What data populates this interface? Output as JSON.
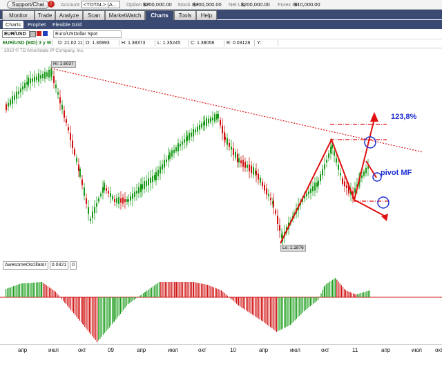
{
  "topbar": {
    "support_label": "Support/Chat",
    "alert_icon": "!",
    "account_label": "Account",
    "account_value": "<TOTAL> (A...",
    "option_bp_label": "Option BP",
    "option_bp_value": "$200,000.00",
    "stock_bp_label": "Stock BP",
    "stock_bp_value": "$300,000.00",
    "net_liq_label": "Net Liq",
    "net_liq_value": "$200,000.00",
    "forex_bp_label": "Forex BP",
    "forex_bp_value": "$10,000.00"
  },
  "tabs": [
    "Monitor",
    "Trade",
    "Analyze",
    "Scan",
    "MarketWatch",
    "Charts",
    "Tools",
    "Help"
  ],
  "active_tab": "Charts",
  "subtabs": [
    "Charts",
    "Prophet",
    "Flexible Grid"
  ],
  "symbol": {
    "ticker": "EUR/USD",
    "description": "Euro/USDollar Spot"
  },
  "info": {
    "period": "EUR/USD (BID) 3 y W",
    "date": "D: 21.02.11",
    "open": "O: 1.36993",
    "high": "H: 1.38373",
    "low": "L: 1.35245",
    "close": "C: 1.38058",
    "range": "R: 0.03128",
    "y": "Y:"
  },
  "copyright": "2010 © TD Ameritrade IP Company, Inc.",
  "hi_label": "Hi: 1.6037",
  "lo_label": "Lo: 1.1876",
  "annotations": {
    "target": "123,8%",
    "pivot": "pivot MF"
  },
  "oscillator": {
    "name": "AwesomeOscillator",
    "value": "0.0321",
    "extra": "0"
  },
  "x_axis": [
    "апр",
    "июл",
    "окт",
    "09",
    "апр",
    "июл",
    "окт",
    "10",
    "апр",
    "июл",
    "окт",
    "11",
    "апр",
    "июл",
    "окт"
  ],
  "colors": {
    "up": "#1a9c1a",
    "down": "#d01010",
    "tab_bar": "#3a4a73",
    "annotation": "#1d2fd1"
  }
}
